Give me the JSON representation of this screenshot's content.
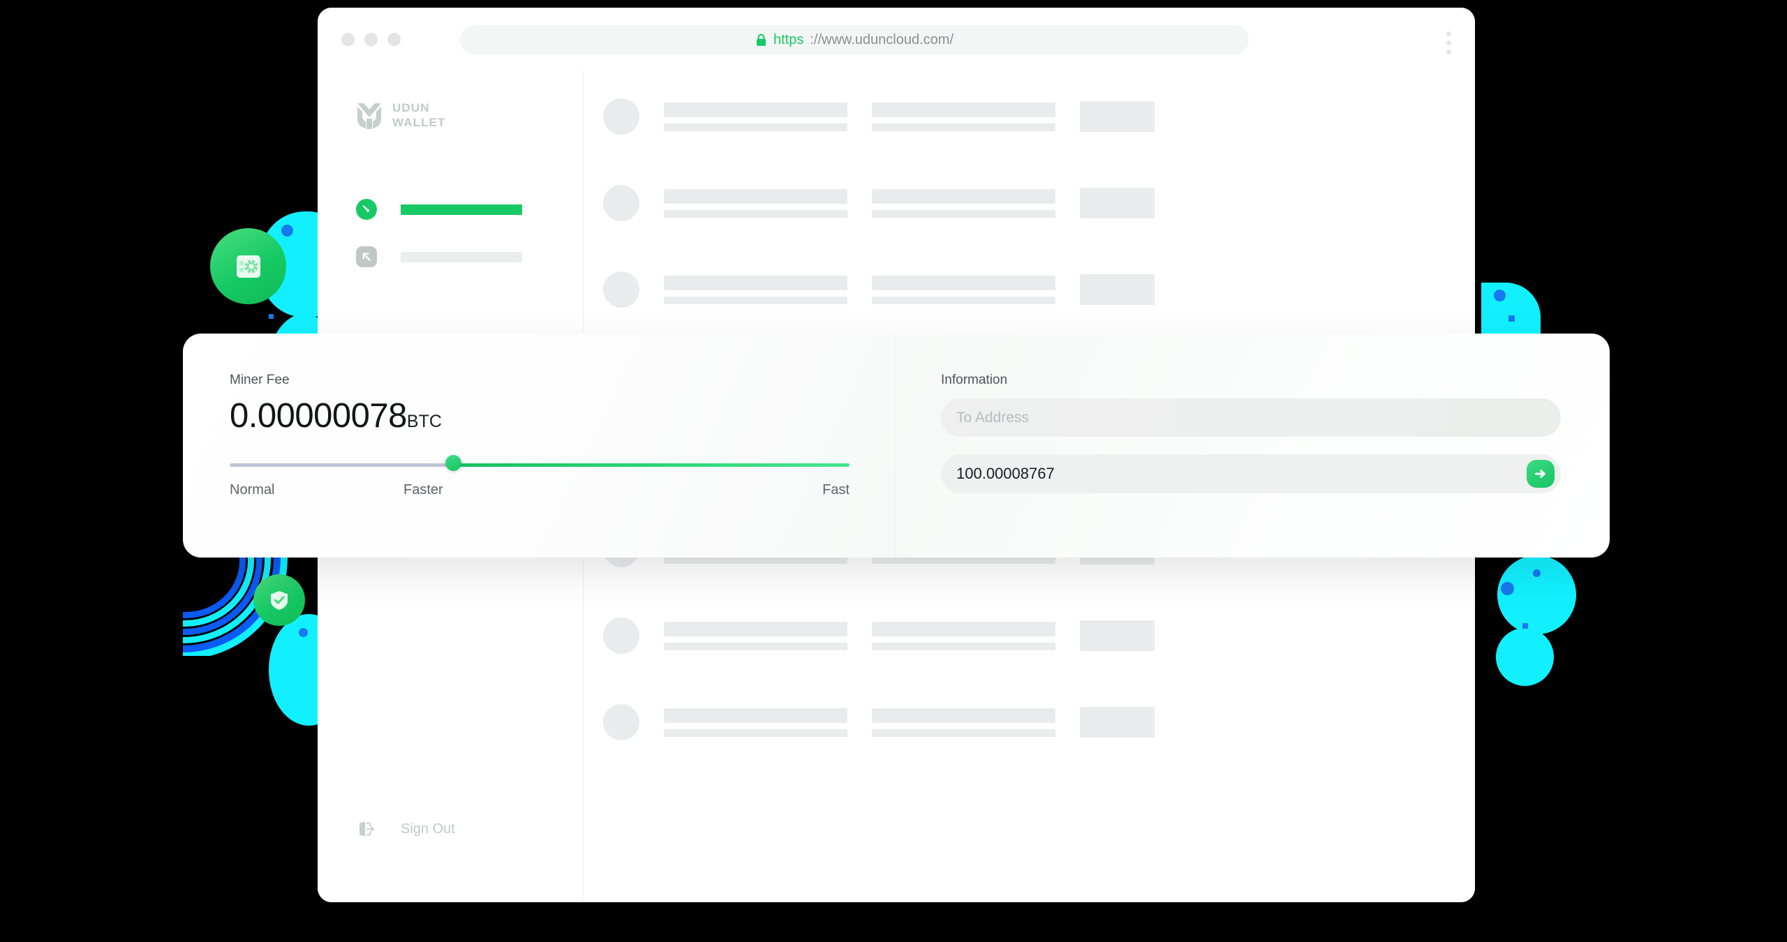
{
  "browser": {
    "url_scheme": "https",
    "url_rest": "://www.uduncloud.com/",
    "lock_icon": "lock-icon",
    "menu_icon": "kebab-menu-icon",
    "traffic_lights": [
      "close",
      "minimize",
      "maximize"
    ]
  },
  "sidebar": {
    "logo": {
      "icon": "udun-logo-icon",
      "line1": "UDUN",
      "line2": "WALLET"
    },
    "items": [
      {
        "icon": "dashboard-gauge-icon",
        "label": "",
        "active": true
      },
      {
        "icon": "transfer-arrow-icon",
        "label": "",
        "active": false
      },
      {
        "icon": "wallet-icon",
        "label": "",
        "active": false
      }
    ],
    "sign_out": {
      "icon": "sign-out-icon",
      "label": "Sign Out"
    }
  },
  "content": {
    "skeleton_rows": 8
  },
  "modal": {
    "left": {
      "label": "Miner Fee",
      "amount": "0.00000078",
      "unit": "BTC",
      "slider": {
        "value_percent": 36,
        "labels": [
          "Normal",
          "Faster",
          "Fast"
        ]
      }
    },
    "right": {
      "label": "Information",
      "to_address_placeholder": "To Address",
      "to_address_value": "",
      "amount_value": "100.00008767",
      "send_icon": "arrow-right-icon"
    }
  },
  "decor": {
    "badges": [
      {
        "icon": "vault-safe-icon"
      },
      {
        "icon": "shield-check-icon"
      }
    ],
    "colors": {
      "accent_green": "#19C965",
      "cyan": "#12F0FF",
      "blue": "#1878F0",
      "url_green": "#18C964"
    }
  }
}
